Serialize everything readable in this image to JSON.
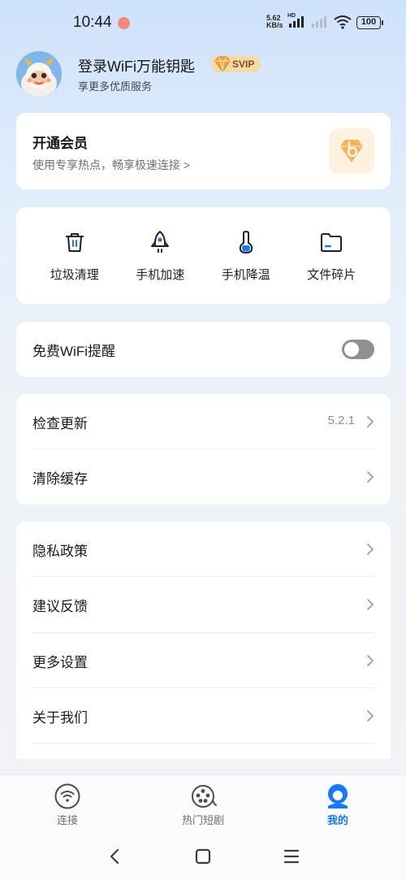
{
  "status_bar": {
    "time": "10:44",
    "net_speed_value": "5.62",
    "net_speed_unit": "KB/s",
    "hd_label": "HD",
    "battery": "100"
  },
  "profile": {
    "login_text": "登录WiFi万能钥匙",
    "badge": "SVIP",
    "subtitle": "享更多优质服务"
  },
  "vip_card": {
    "title": "开通会员",
    "description": "使用专享热点，畅享极速连接 >"
  },
  "tools": [
    {
      "label": "垃圾清理",
      "icon": "trash-icon"
    },
    {
      "label": "手机加速",
      "icon": "rocket-icon"
    },
    {
      "label": "手机降温",
      "icon": "thermometer-icon"
    },
    {
      "label": "文件碎片",
      "icon": "folder-icon"
    }
  ],
  "wifi_reminder": {
    "label": "免费WiFi提醒",
    "enabled": false
  },
  "settings_group_1": {
    "check_update_label": "检查更新",
    "version": "5.2.1",
    "clear_cache_label": "清除缓存"
  },
  "settings_group_2": {
    "privacy_label": "隐私政策",
    "feedback_label": "建议反馈",
    "more_settings_label": "更多设置",
    "about_label": "关于我们"
  },
  "tab_bar": {
    "connect": "连接",
    "dramas": "热门短剧",
    "me": "我的",
    "active": "me"
  },
  "colors": {
    "accent": "#1678ff",
    "svip_bg": "#f6d9a6",
    "svip_text": "#8a4d12"
  }
}
